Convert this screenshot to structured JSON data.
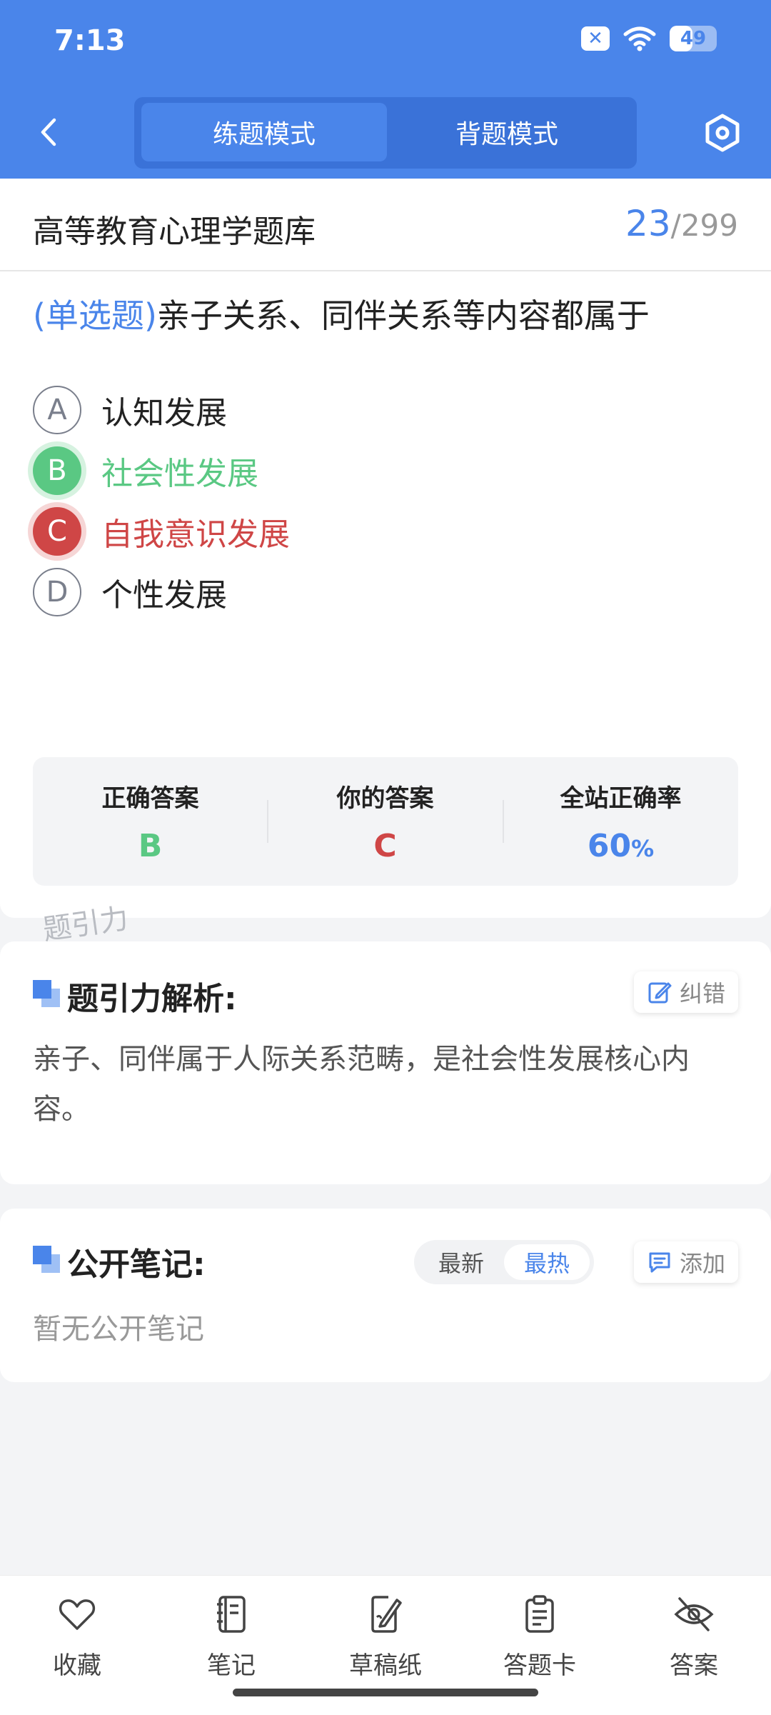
{
  "status_bar": {
    "time": "7:13",
    "battery": "49",
    "battery_level": 0.49
  },
  "nav": {
    "tab_practice": "练题模式",
    "tab_memorize": "背题模式",
    "active_tab": "practice"
  },
  "header": {
    "bank_title": "高等教育心理学题库",
    "current": "23",
    "separator": "/",
    "total": "299"
  },
  "question": {
    "type_label": "(单选题)",
    "text": "亲子关系、同伴关系等内容都属于",
    "options": [
      {
        "letter": "A",
        "text": "认知发展",
        "state": "normal"
      },
      {
        "letter": "B",
        "text": "社会性发展",
        "state": "correct"
      },
      {
        "letter": "C",
        "text": "自我意识发展",
        "state": "wrong"
      },
      {
        "letter": "D",
        "text": "个性发展",
        "state": "normal"
      }
    ]
  },
  "answer_summary": {
    "correct_label": "正确答案",
    "correct_value": "B",
    "yours_label": "你的答案",
    "yours_value": "C",
    "rate_label": "全站正确率",
    "rate_value": "60",
    "rate_unit": "%"
  },
  "watermark": "题引力",
  "analysis": {
    "title": "题引力解析:",
    "correct_btn": "纠错",
    "text": "亲子、同伴属于人际关系范畴，是社会性发展核心内容。"
  },
  "notes": {
    "title": "公开笔记:",
    "sort_new": "最新",
    "sort_hot": "最热",
    "add_btn": "添加",
    "empty_text": "暂无公开笔记"
  },
  "bottom_tabs": [
    {
      "label": "收藏",
      "icon": "heart-icon"
    },
    {
      "label": "笔记",
      "icon": "notebook-icon"
    },
    {
      "label": "草稿纸",
      "icon": "draft-icon"
    },
    {
      "label": "答题卡",
      "icon": "clipboard-icon"
    },
    {
      "label": "答案",
      "icon": "eye-off-icon"
    }
  ],
  "colors": {
    "primary": "#4a85ea",
    "correct": "#5ac883",
    "wrong": "#cf4646"
  }
}
